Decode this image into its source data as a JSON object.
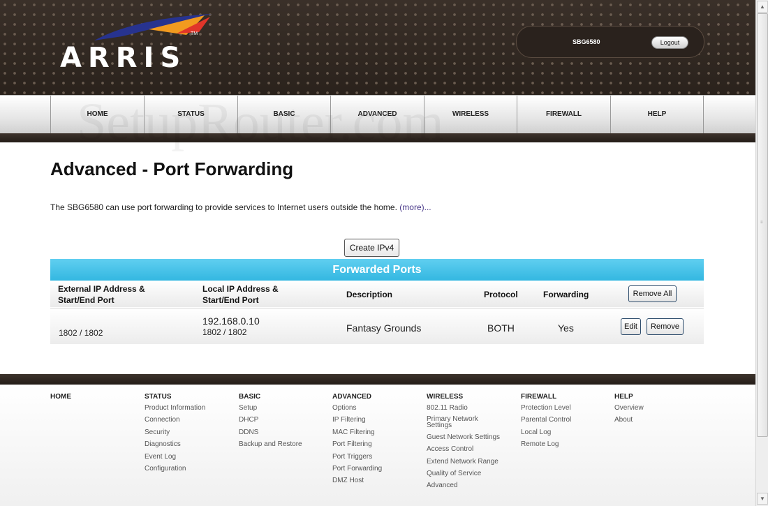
{
  "header": {
    "logo_text": "ARRIS",
    "logo_tm": "TM",
    "device_name": "SBG6580",
    "logout_label": "Logout"
  },
  "nav": {
    "items": [
      {
        "label": "HOME"
      },
      {
        "label": "STATUS"
      },
      {
        "label": "BASIC"
      },
      {
        "label": "ADVANCED"
      },
      {
        "label": "WIRELESS"
      },
      {
        "label": "FIREWALL"
      },
      {
        "label": "HELP"
      }
    ]
  },
  "watermark": "SetupRouter.com",
  "main": {
    "title": "Advanced - Port Forwarding",
    "intro_text": "The SBG6580 can use port forwarding to provide services to Internet users outside the home.",
    "intro_more": "(more)...",
    "create_button": "Create IPv4",
    "table": {
      "title": "Forwarded Ports",
      "headers": {
        "external_line1": "External IP Address &",
        "external_line2": "Start/End Port",
        "local_line1": "Local IP Address &",
        "local_line2": "Start/End Port",
        "description": "Description",
        "protocol": "Protocol",
        "forwarding": "Forwarding",
        "remove_all": "Remove All"
      },
      "rows": [
        {
          "external_port": "1802 / 1802",
          "local_ip": "192.168.0.10",
          "local_port": "1802 / 1802",
          "description": "Fantasy Grounds",
          "protocol": "BOTH",
          "forwarding": "Yes",
          "edit_label": "Edit",
          "remove_label": "Remove"
        }
      ]
    }
  },
  "footer": {
    "columns": [
      {
        "heading": "HOME",
        "links": []
      },
      {
        "heading": "STATUS",
        "links": [
          "Product Information",
          "Connection",
          "Security",
          "Diagnostics",
          "Event Log",
          "Configuration"
        ]
      },
      {
        "heading": "BASIC",
        "links": [
          "Setup",
          "DHCP",
          "DDNS",
          "Backup and Restore"
        ]
      },
      {
        "heading": "ADVANCED",
        "links": [
          "Options",
          "IP Filtering",
          "MAC Filtering",
          "Port Filtering",
          "Port Triggers",
          "Port Forwarding",
          "DMZ Host"
        ]
      },
      {
        "heading": "WIRELESS",
        "links": [
          "802.11 Radio",
          "Primary Network Settings",
          "Guest Network Settings",
          "Access Control",
          "Extend Network Range",
          "Quality of Service",
          "Advanced"
        ]
      },
      {
        "heading": "FIREWALL",
        "links": [
          "Protection Level",
          "Parental Control",
          "Local Log",
          "Remote Log"
        ]
      },
      {
        "heading": "HELP",
        "links": [
          "Overview",
          "About"
        ]
      }
    ]
  },
  "colors": {
    "table_header": "#33b7e1",
    "header_bg": "#2e2620",
    "link": "#4a3a8a"
  }
}
